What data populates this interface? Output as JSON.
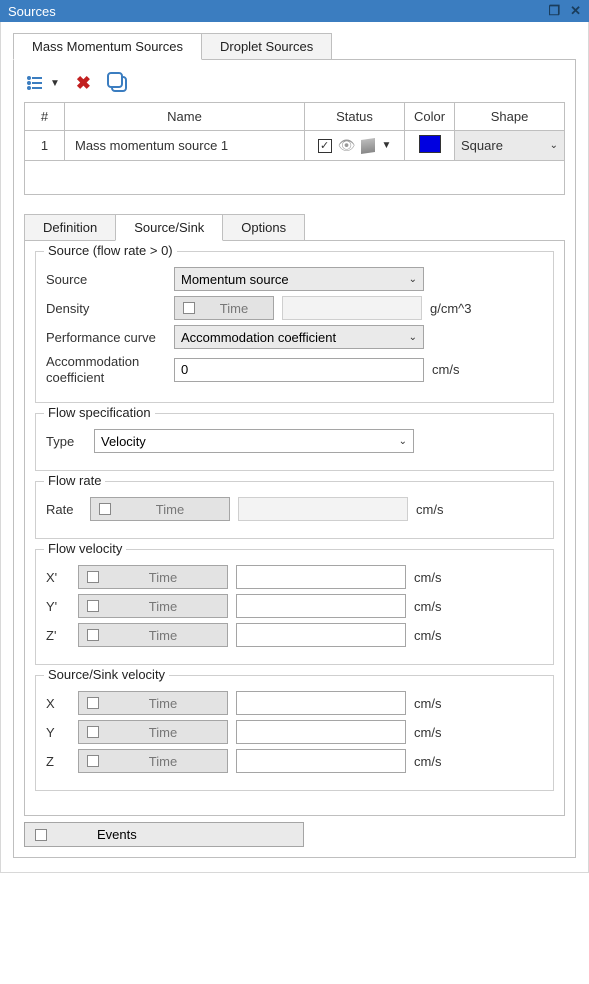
{
  "window": {
    "title": "Sources"
  },
  "topTabs": [
    "Mass Momentum Sources",
    "Droplet Sources"
  ],
  "tableHeaders": {
    "num": "#",
    "name": "Name",
    "status": "Status",
    "color": "Color",
    "shape": "Shape"
  },
  "tableRow": {
    "num": "1",
    "name": "Mass momentum source 1",
    "shape": "Square"
  },
  "innerTabs": [
    "Definition",
    "Source/Sink",
    "Options"
  ],
  "sourceGroup": {
    "legend": "Source (flow rate > 0)",
    "sourceLabel": "Source",
    "sourceValue": "Momentum source",
    "densityLabel": "Density",
    "densityUnit": "g/cm^3",
    "perfLabel": "Performance curve",
    "perfValue": "Accommodation coefficient",
    "accomLabel": "Accommodation coefficient",
    "accomValue": "0",
    "accomUnit": "cm/s",
    "timeLabel": "Time"
  },
  "flowSpec": {
    "legend": "Flow specification",
    "typeLabel": "Type",
    "typeValue": "Velocity"
  },
  "flowRate": {
    "legend": "Flow rate",
    "rateLabel": "Rate",
    "timeLabel": "Time",
    "unit": "cm/s"
  },
  "flowVelocity": {
    "legend": "Flow velocity",
    "axes": [
      "X'",
      "Y'",
      "Z'"
    ],
    "timeLabel": "Time",
    "unit": "cm/s"
  },
  "sinkVelocity": {
    "legend": "Source/Sink velocity",
    "axes": [
      "X",
      "Y",
      "Z"
    ],
    "timeLabel": "Time",
    "unit": "cm/s"
  },
  "eventsLabel": "Events"
}
